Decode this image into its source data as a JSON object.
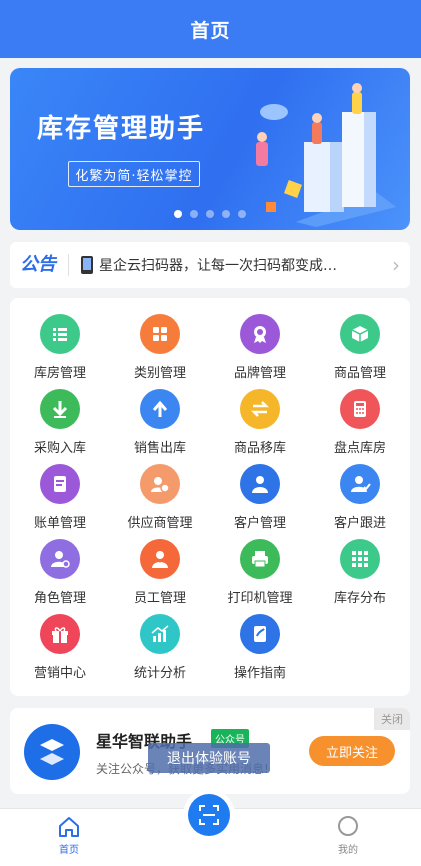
{
  "header": {
    "title": "首页"
  },
  "banner": {
    "title": "库存管理助手",
    "subtitle": "化繁为简·轻松掌控",
    "slide_count": 5,
    "active_slide": 1
  },
  "notice": {
    "tag": "公告",
    "text": "星企云扫码器，让每一次扫码都变成…"
  },
  "menu": {
    "items": [
      {
        "label": "库房管理",
        "icon": "list-icon",
        "color": "#3dc98a"
      },
      {
        "label": "类别管理",
        "icon": "grid-icon",
        "color": "#f57c3a"
      },
      {
        "label": "品牌管理",
        "icon": "award-icon",
        "color": "#9b59d9"
      },
      {
        "label": "商品管理",
        "icon": "box-icon",
        "color": "#3dc98a"
      },
      {
        "label": "采购入库",
        "icon": "arrow-down-icon",
        "color": "#3dbb5a"
      },
      {
        "label": "销售出库",
        "icon": "arrow-up-icon",
        "color": "#3b86f0"
      },
      {
        "label": "商品移库",
        "icon": "swap-icon",
        "color": "#f5b62a"
      },
      {
        "label": "盘点库房",
        "icon": "calculator-icon",
        "color": "#f0555a"
      },
      {
        "label": "账单管理",
        "icon": "document-icon",
        "color": "#9b59d9"
      },
      {
        "label": "供应商管理",
        "icon": "supplier-icon",
        "color": "#f59a6a"
      },
      {
        "label": "客户管理",
        "icon": "person-icon",
        "color": "#2f74e6"
      },
      {
        "label": "客户跟进",
        "icon": "follow-up-icon",
        "color": "#3b86f0"
      },
      {
        "label": "角色管理",
        "icon": "role-icon",
        "color": "#8e6ee0"
      },
      {
        "label": "员工管理",
        "icon": "staff-icon",
        "color": "#f5683a"
      },
      {
        "label": "打印机管理",
        "icon": "printer-icon",
        "color": "#3dbb5a"
      },
      {
        "label": "库存分布",
        "icon": "distribution-icon",
        "color": "#3dc98a"
      },
      {
        "label": "营销中心",
        "icon": "gift-icon",
        "color": "#f0465a"
      },
      {
        "label": "统计分析",
        "icon": "chart-icon",
        "color": "#2fc6c8"
      },
      {
        "label": "操作指南",
        "icon": "guide-icon",
        "color": "#2f74e6"
      }
    ]
  },
  "promo": {
    "name": "星华智联助手",
    "badge": "公众号",
    "desc": "关注公众号，获取更多实用消息!",
    "follow": "立即关注",
    "close": "关闭"
  },
  "overlay": {
    "exit": "退出体验账号"
  },
  "tabbar": {
    "home": "首页",
    "mine": "我的"
  }
}
